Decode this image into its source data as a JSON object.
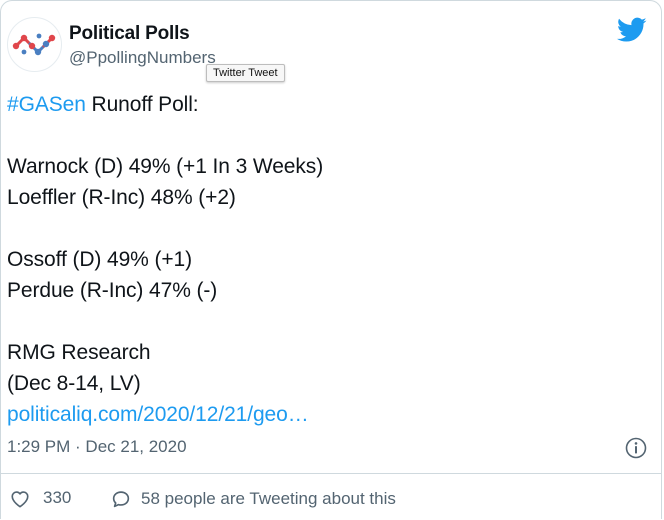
{
  "author": {
    "display_name": "Political Polls",
    "handle": "@PpollingNumbers"
  },
  "tooltip": "Twitter Tweet",
  "tweet": {
    "hashtag": "#GASen",
    "line1_rest": " Runoff Poll:",
    "line2": "Warnock (D) 49% (+1 In 3 Weeks)",
    "line3": "Loeffler (R-Inc) 48% (+2)",
    "line4": "Ossoff (D) 49% (+1)",
    "line5": "Perdue (R-Inc) 47% (-)",
    "line6": "RMG Research",
    "line7": "(Dec 8-14, LV)",
    "link": "politicaliq.com/2020/12/21/geo…"
  },
  "timestamp": "1:29 PM · Dec 21, 2020",
  "actions": {
    "like_count": "330",
    "reply_text": "58 people are Tweeting about this"
  },
  "colors": {
    "brand_blue": "#1d9bf0",
    "secondary_text": "#536471",
    "logo_red": "#e0464b",
    "logo_blue": "#4a7fc1"
  },
  "icons": {
    "brand": "twitter-bird-icon",
    "info": "info-icon",
    "like": "heart-icon",
    "reply": "speech-bubble-icon",
    "avatar": "political-polls-logo"
  }
}
